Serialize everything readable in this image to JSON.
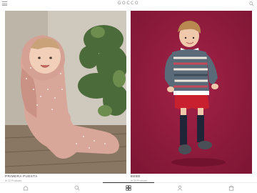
{
  "header": {
    "brand": "GOCCO"
  },
  "cards": [
    {
      "title": "PRIMERA PUESTA",
      "subtitle": "In 12 Products"
    },
    {
      "title": "BEBÉ",
      "subtitle": "In 30 Products"
    }
  ],
  "tabbar": {
    "active": "categories-tab",
    "tabs": [
      "home-icon",
      "search-icon",
      "grid-icon",
      "user-icon",
      "shopping-bag-icon"
    ]
  },
  "colors": {
    "accent": "#333333",
    "left_background": "#b7b0a3",
    "right_background": "#8f1b3a"
  }
}
